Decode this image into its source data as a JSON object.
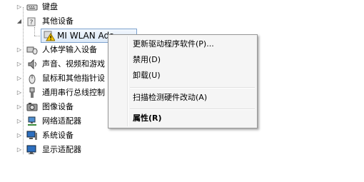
{
  "tree": {
    "items": [
      {
        "label": "键盘",
        "expanded": false,
        "icon": "keyboard-icon"
      },
      {
        "label": "其他设备",
        "expanded": true,
        "icon": "unknown-device-icon"
      },
      {
        "label": "MI WLAN Ada",
        "child": true,
        "icon": "warning-icon"
      },
      {
        "label": "人体学输入设备",
        "expanded": false,
        "icon": "hid-icon"
      },
      {
        "label": "声音、视频和游戏",
        "expanded": false,
        "icon": "speaker-icon"
      },
      {
        "label": "鼠标和其他指针设",
        "expanded": false,
        "icon": "mouse-icon"
      },
      {
        "label": "通用串行总线控制",
        "expanded": false,
        "icon": "usb-icon"
      },
      {
        "label": "图像设备",
        "expanded": false,
        "icon": "camera-icon"
      },
      {
        "label": "网络适配器",
        "expanded": false,
        "icon": "network-icon"
      },
      {
        "label": "系统设备",
        "expanded": false,
        "icon": "computer-icon"
      },
      {
        "label": "显示适配器",
        "expanded": false,
        "icon": "display-icon"
      }
    ]
  },
  "context_menu": {
    "update_driver": "更新驱动程序软件(P)...",
    "disable": "禁用(D)",
    "uninstall": "卸载(U)",
    "scan": "扫描检测硬件改动(A)",
    "properties": "属性(R)"
  }
}
